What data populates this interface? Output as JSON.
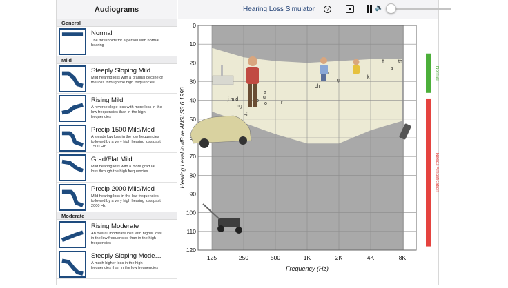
{
  "sidebar": {
    "title": "Audiograms",
    "sections": [
      {
        "label": "General",
        "items": [
          {
            "title": "Normal",
            "desc": "The thresholds for a person with normal hearing"
          }
        ]
      },
      {
        "label": "Mild",
        "items": [
          {
            "title": "Steeply Sloping Mild",
            "desc": "Mild hearing loss with a gradual decline of the loss through the high frequencies"
          },
          {
            "title": "Rising Mild",
            "desc": "A reverse slope loss with more loss in the low frequencies than in the high frequencies"
          },
          {
            "title": "Precip 1500 Mild/Mod",
            "desc": "A steady low loss in the low frequencies followed by a very high hearing loss past 1500 Hz"
          },
          {
            "title": "Grad/Flat Mild",
            "desc": "Mild hearing loss with a more gradual loss through the high frequencies"
          },
          {
            "title": "Precip 2000 Mild/Mod",
            "desc": "Mild hearing loss in the low frequencies followed by a very high hearing loss past 2000 Hz"
          }
        ]
      },
      {
        "label": "Moderate",
        "items": [
          {
            "title": "Rising Moderate",
            "desc": "An overall moderate loss with higher loss in the low frequencies than in the high frequencies"
          },
          {
            "title": "Steeply Sloping Mode…",
            "desc": "A much higher loss in the high frequencies than in the low frequencies"
          }
        ]
      }
    ]
  },
  "toolbar": {
    "title": "Hearing Loss Simulator",
    "help_label": "?",
    "volume_icon": "🔈",
    "volume_level": 0.05
  },
  "chart_data": {
    "type": "audiogram",
    "xlabel": "Frequency (Hz)",
    "ylabel": "Hearing Level in dB re ANSI S3.6 1996",
    "x_ticks": [
      "125",
      "250",
      "500",
      "1K",
      "2K",
      "4K",
      "8K"
    ],
    "y_ticks": [
      0,
      10,
      20,
      30,
      40,
      50,
      60,
      70,
      80,
      90,
      100,
      110,
      120
    ],
    "ylim": [
      0,
      120
    ],
    "speech_letters": [
      {
        "t": "j",
        "f": 0.0,
        "db": 0
      },
      {
        "t": "m",
        "x": 1.05,
        "db": 38
      },
      {
        "t": "d",
        "x": 1.12,
        "db": 38
      },
      {
        "t": "b",
        "x": 1.3,
        "db": 39
      },
      {
        "t": "n",
        "x": 1.08,
        "db": 41.5
      },
      {
        "t": "g",
        "x": 1.17,
        "db": 40
      },
      {
        "t": "e",
        "x": 1.2,
        "db": 37
      },
      {
        "t": "u",
        "x": 1.42,
        "db": 34
      },
      {
        "t": "a",
        "x": 1.45,
        "db": 37
      },
      {
        "t": "o",
        "x": 1.44,
        "db": 40
      },
      {
        "t": "r",
        "x": 1.8,
        "db": 42
      },
      {
        "t": "i",
        "x": 1.19,
        "db": 45.5
      },
      {
        "t": "ch",
        "x": 2.35,
        "db": 31
      },
      {
        "t": "p",
        "x": 2.48,
        "db": 27
      },
      {
        "t": "h",
        "x": 2.55,
        "db": 27
      },
      {
        "t": "g",
        "x": 2.8,
        "db": 29
      },
      {
        "t": "k",
        "x": 3.6,
        "db": 27
      },
      {
        "t": "f",
        "x": 4.15,
        "db": 19
      },
      {
        "t": "s",
        "x": 4.35,
        "db": 23
      },
      {
        "t": "th",
        "x": 4.6,
        "db": 19
      }
    ],
    "side_bars": [
      {
        "label": "Normal",
        "color": "#4caf3a",
        "db_from": 15,
        "db_to": 36
      },
      {
        "label": "Needs Amplification",
        "color": "#e5433f",
        "db_from": 39,
        "db_to": 118
      }
    ],
    "jm_label": "j m d",
    "jm_label2": "ng"
  }
}
